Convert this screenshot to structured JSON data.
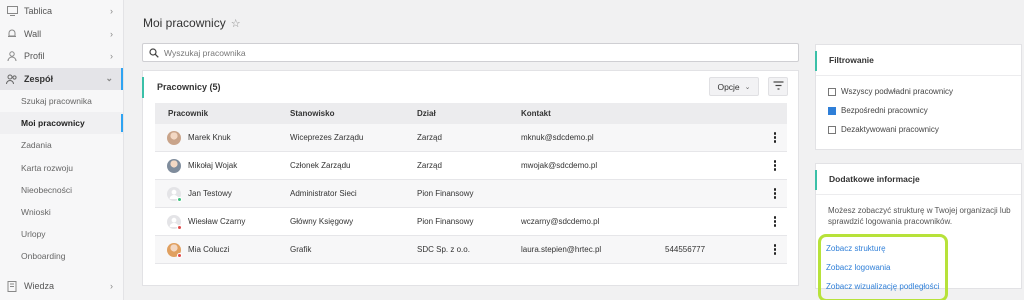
{
  "sidebar": {
    "top_items": [
      {
        "label": "Tablica",
        "icon": "monitor-icon"
      },
      {
        "label": "Wall",
        "icon": "bell-icon"
      },
      {
        "label": "Profil",
        "icon": "user-icon"
      }
    ],
    "team": {
      "label": "Zespół",
      "icon": "users-icon"
    },
    "sub_items": [
      "Szukaj pracownika",
      "Moi pracownicy",
      "Zadania",
      "Karta rozwoju",
      "Nieobecności",
      "Wnioski",
      "Urlopy",
      "Onboarding"
    ],
    "active_sub": "Moi pracownicy",
    "bottom_item": {
      "label": "Wiedza",
      "icon": "book-icon"
    }
  },
  "header": {
    "title": "Moi pracownicy"
  },
  "search": {
    "placeholder": "Wyszukaj pracownika"
  },
  "list": {
    "title": "Pracownicy (5)",
    "options_label": "Opcje",
    "columns": [
      "Pracownik",
      "Stanowisko",
      "Dział",
      "Kontakt",
      ""
    ],
    "rows": [
      {
        "name": "Marek Knuk",
        "position": "Wiceprezes Zarządu",
        "department": "Zarząd",
        "email": "mknuk@sdcdemo.pl",
        "phone": "",
        "avatar": "photo",
        "avatar_color": "#c9a48a",
        "status_color": ""
      },
      {
        "name": "Mikołaj Wojak",
        "position": "Członek Zarządu",
        "department": "Zarząd",
        "email": "mwojak@sdcdemo.pl",
        "phone": "",
        "avatar": "photo",
        "avatar_color": "#7f8c9c",
        "status_color": ""
      },
      {
        "name": "Jan Testowy",
        "position": "Administrator Sieci",
        "department": "Pion Finansowy",
        "email": "",
        "phone": "",
        "avatar": "placeholder",
        "avatar_color": "#d4d4d8",
        "status_color": "#3ac07a"
      },
      {
        "name": "Wiesław Czarny",
        "position": "Główny Księgowy",
        "department": "Pion Finansowy",
        "email": "wczarny@sdcdemo.pl",
        "phone": "",
        "avatar": "placeholder",
        "avatar_color": "#d4d4d8",
        "status_color": "#e04848"
      },
      {
        "name": "Mia Coluczi",
        "position": "Grafik",
        "department": "SDC Sp. z o.o.",
        "email": "laura.stepien@hrtec.pl",
        "phone": "544556777",
        "avatar": "photo",
        "avatar_color": "#e0a060",
        "status_color": "#e04848"
      }
    ]
  },
  "filters": {
    "title": "Filtrowanie",
    "options": [
      {
        "label": "Wszyscy podwładni pracownicy",
        "checked": false
      },
      {
        "label": "Bezpośredni pracownicy",
        "checked": true
      },
      {
        "label": "Dezaktywowani pracownicy",
        "checked": false
      }
    ]
  },
  "info": {
    "title": "Dodatkowe informacje",
    "text": "Możesz zobaczyć strukturę w Twojej organizacji lub sprawdzić logowania pracowników.",
    "links": [
      "Zobacz strukturę",
      "Zobacz logowania",
      "Zobacz wizualizację podległości"
    ]
  },
  "colors": {
    "accent_teal": "#3ac0a8",
    "link_blue": "#2f7fd8",
    "highlight_green": "#b7e23a",
    "active_blue": "#2ea3f2"
  }
}
